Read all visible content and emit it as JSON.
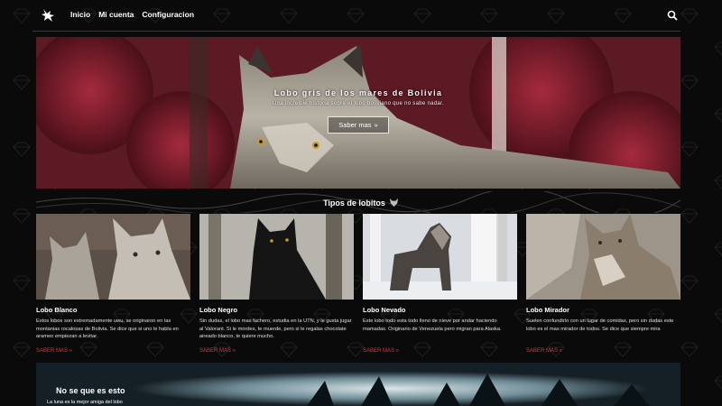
{
  "nav": {
    "links": [
      "Inicio",
      "Mi cuenta",
      "Configuracion"
    ]
  },
  "hero": {
    "title": "Lobo gris de los mares de Bolivia",
    "subtitle": "Una increible historia sobre el lobo boliviano que no sabe nadar.",
    "button_label": "Saber mas",
    "button_arrows": "»"
  },
  "section": {
    "title": "Tipos de lobitos",
    "icon": "wolf-icon"
  },
  "cards": [
    {
      "title": "Lobo Blanco",
      "text": "Estos lobos son extremadamente uwu, se originaron en las montanias rocalosas de Bolivia. Se dice que si uno le habla en arameo empiezan a levitar.",
      "link": "SABER MAS »"
    },
    {
      "title": "Lobo Negro",
      "text": "Sin dudas, el lobo mas fachero, estudia en la UTN, y le gusta jugar al Valorant. Si le mordes, te muerde, pero si le regalas chocolate aireado blanco, te quiere mucho.",
      "link": "SABER MAS »"
    },
    {
      "title": "Lobo Nevado",
      "text": "Este lobo todo esta todo lleno de nieve por andar haciendo mamadas. Originario de Venezuela pero migran para Alaska.",
      "link": "SABER MAS »"
    },
    {
      "title": "Lobo Mirador",
      "text": "Suelen confundirlo con un lugar de comidas, pero sin dudas este lobo es el mas mirador de todos. Se dice que siempre mira",
      "link": "SABER MAS »"
    }
  ],
  "banner": {
    "title": "No se que es esto",
    "subtitle": "La luna es la mejor amiga del lobo"
  },
  "colors": {
    "background": "#0a0a0a",
    "link_red": "#d43a3a",
    "hero_red": "#7a1c2c"
  }
}
